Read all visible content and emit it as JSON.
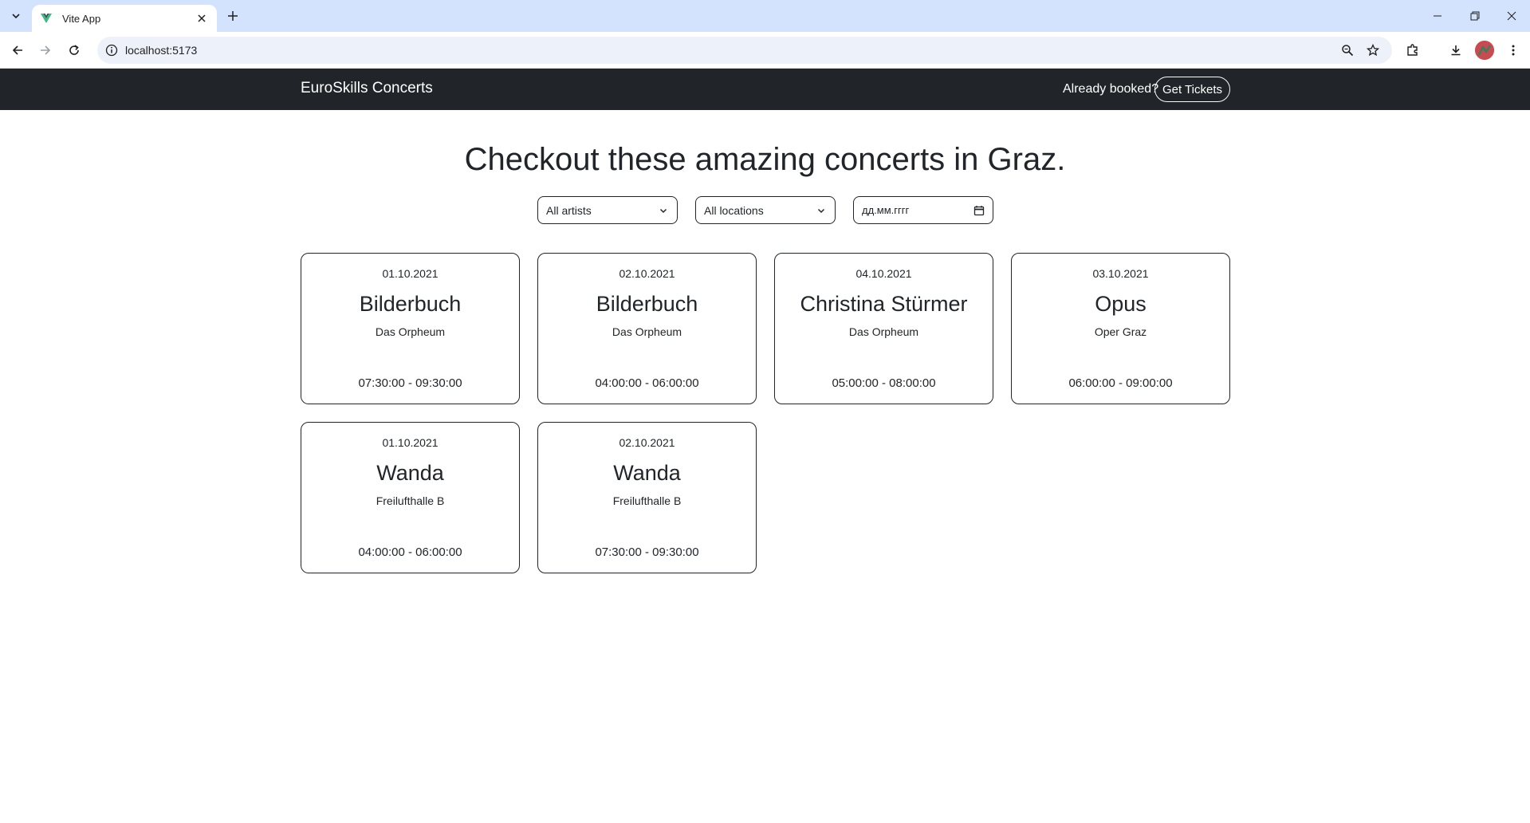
{
  "browser": {
    "tab_title": "Vite App",
    "url": "localhost:5173"
  },
  "navbar": {
    "brand": "EuroSkills Concerts",
    "already_booked": "Already booked?",
    "get_tickets": "Get Tickets"
  },
  "main": {
    "heading": "Checkout these amazing concerts in Graz.",
    "filters": {
      "artist": "All artists",
      "location": "All locations",
      "date_placeholder": "дд.мм.гггг"
    },
    "concerts": [
      {
        "date": "01.10.2021",
        "artist": "Bilderbuch",
        "location": "Das Orpheum",
        "time": "07:30:00 - 09:30:00"
      },
      {
        "date": "02.10.2021",
        "artist": "Bilderbuch",
        "location": "Das Orpheum",
        "time": "04:00:00 - 06:00:00"
      },
      {
        "date": "04.10.2021",
        "artist": "Christina Stürmer",
        "location": "Das Orpheum",
        "time": "05:00:00 - 08:00:00"
      },
      {
        "date": "03.10.2021",
        "artist": "Opus",
        "location": "Oper Graz",
        "time": "06:00:00 - 09:00:00"
      },
      {
        "date": "01.10.2021",
        "artist": "Wanda",
        "location": "Freilufthalle B",
        "time": "04:00:00 - 06:00:00"
      },
      {
        "date": "02.10.2021",
        "artist": "Wanda",
        "location": "Freilufthalle B",
        "time": "07:30:00 - 09:30:00"
      }
    ]
  }
}
